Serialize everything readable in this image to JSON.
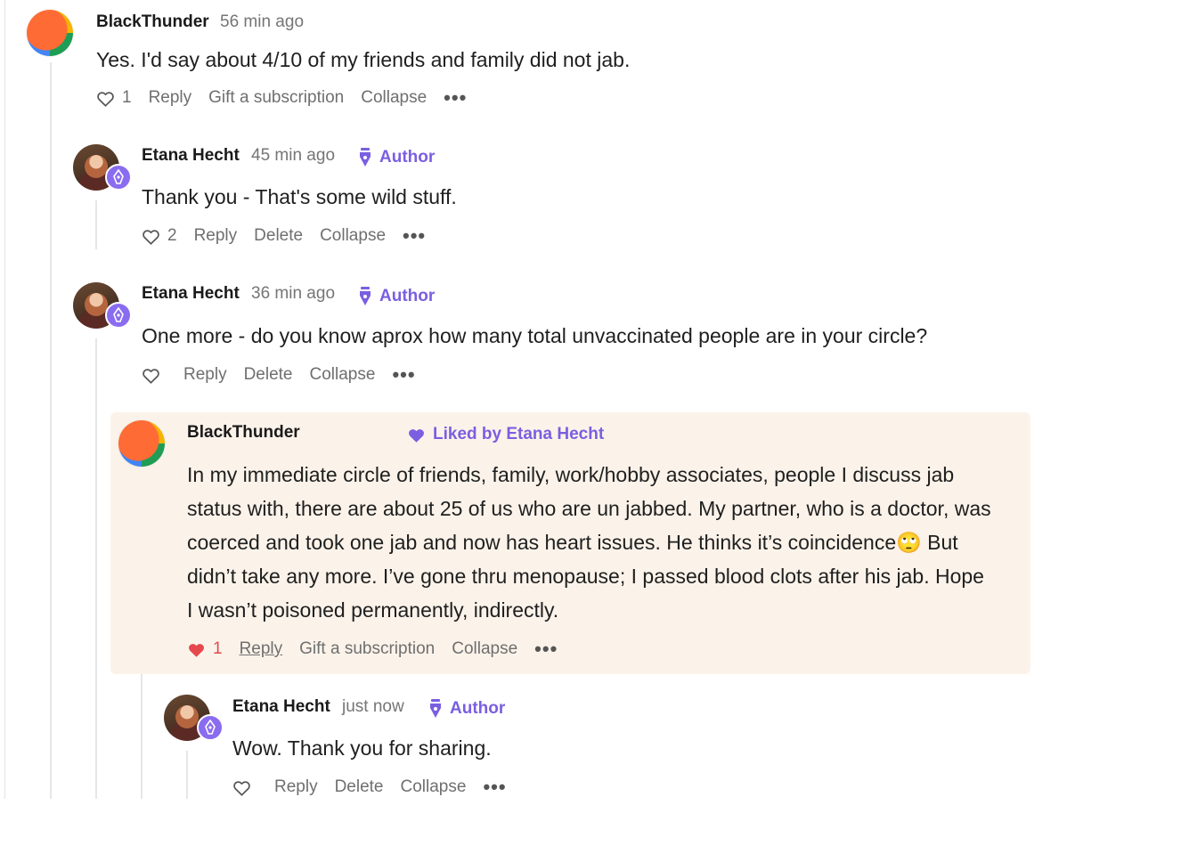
{
  "colors": {
    "accent": "#7a5fe0",
    "like_red": "#e5484d",
    "highlight_bg": "#fbf3ea"
  },
  "icons": {
    "like": "heart-outline-icon",
    "liked": "heart-filled-icon",
    "author": "pen-nib-icon",
    "more": "more-dots-icon"
  },
  "comments": [
    {
      "author": "BlackThunder",
      "time": "56 min ago",
      "text": "Yes. I'd say about 4/10 of my friends and family did not jab.",
      "likes": "1",
      "actions": [
        "Reply",
        "Gift a subscription",
        "Collapse"
      ],
      "more": "•••"
    },
    {
      "author": "Etana Hecht",
      "time": "45 min ago",
      "badge": "Author",
      "text": "Thank you - That's some wild stuff.",
      "likes": "2",
      "actions": [
        "Reply",
        "Delete",
        "Collapse"
      ],
      "more": "•••"
    },
    {
      "author": "Etana Hecht",
      "time": "36 min ago",
      "badge": "Author",
      "text": "One more - do you know aprox how many total unvaccinated people are in your circle?",
      "likes": "",
      "actions": [
        "Reply",
        "Delete",
        "Collapse"
      ],
      "more": "•••"
    },
    {
      "author": "BlackThunder",
      "liked_by": "Liked by Etana Hecht",
      "text_lines": [
        "In my immediate circle of friends, family, work/hobby associates, people I discuss jab",
        "status with, there are about 25 of us who are un jabbed. My partner, who is a doctor, was",
        "coerced and took one jab and now has heart issues. He thinks it’s coincidence🙄 But",
        "didn’t take any more. I’ve gone thru menopause; I passed blood clots after his jab. Hope",
        "I wasn’t poisoned permanently, indirectly."
      ],
      "likes": "1",
      "actions": [
        "Reply",
        "Gift a subscription",
        "Collapse"
      ],
      "more": "•••"
    },
    {
      "author": "Etana Hecht",
      "time": "just now",
      "badge": "Author",
      "text": "Wow. Thank you for sharing.",
      "likes": "",
      "actions": [
        "Reply",
        "Delete",
        "Collapse"
      ],
      "more": "•••"
    }
  ]
}
